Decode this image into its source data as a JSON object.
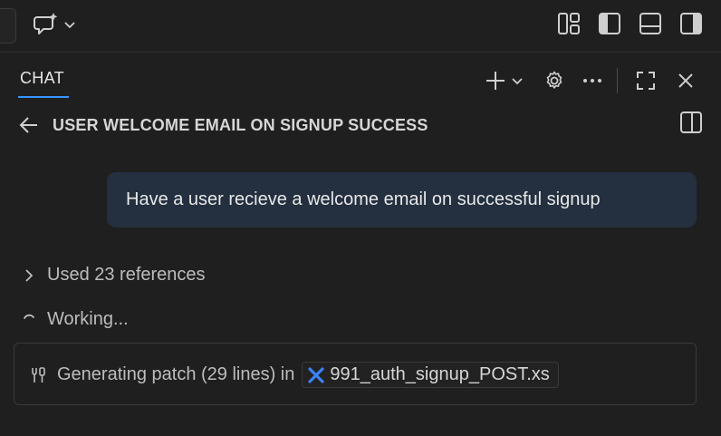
{
  "chat": {
    "tab_label": "CHAT",
    "session_title": "USER WELCOME EMAIL ON SIGNUP SUCCESS"
  },
  "messages": {
    "user": "Have a user recieve a welcome email on successful signup"
  },
  "status": {
    "references": "Used 23 references",
    "working": "Working...",
    "progress_text": "Generating patch (29 lines) in",
    "file_name": "991_auth_signup_POST.xs"
  },
  "icons": {
    "copilot": "copilot-chat-icon",
    "file": "x-file-icon"
  },
  "colors": {
    "accent": "#3794ff",
    "bubble": "#243040",
    "file_icon": "#3b82f6"
  }
}
